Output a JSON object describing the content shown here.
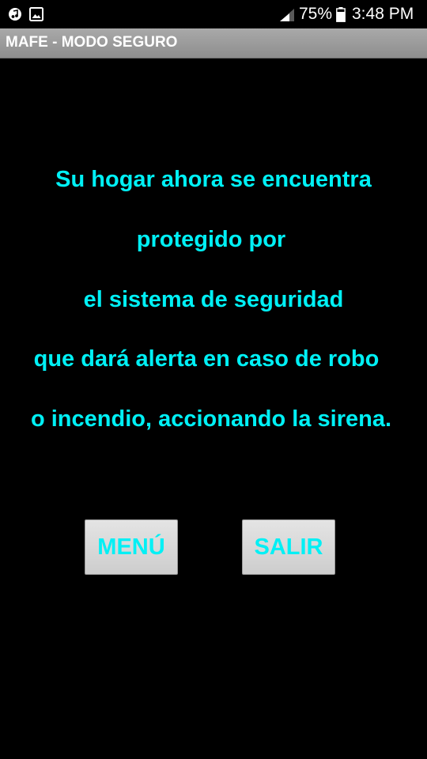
{
  "status_bar": {
    "battery_percent": "75%",
    "time": "3:48 PM",
    "icons": [
      "music-icon",
      "image-icon",
      "signal-icon",
      "battery-icon"
    ]
  },
  "app": {
    "title": "MAFE - MODO SEGURO"
  },
  "message": {
    "lines": [
      "Su hogar ahora se encuentra",
      "protegido por",
      "el sistema de seguridad",
      "que dará alerta en caso de robo",
      "o incendio, accionando la sirena."
    ]
  },
  "buttons": {
    "menu_label": "MENÚ",
    "exit_label": "SALIR"
  },
  "colors": {
    "background": "#000000",
    "accent_text": "#00f0f5",
    "title_bar": "#9c9c9c",
    "button_face": "#d9d9d9"
  }
}
